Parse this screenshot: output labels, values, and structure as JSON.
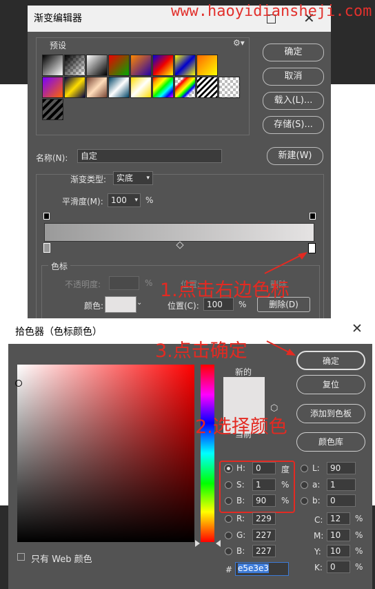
{
  "watermark": "www.haoyidiansheji.com",
  "gradient_editor": {
    "title": "渐变编辑器",
    "presets_label": "预设",
    "buttons": {
      "ok": "确定",
      "cancel": "取消",
      "load": "载入(L)...",
      "save": "存储(S)...",
      "new": "新建(W)"
    },
    "name_label": "名称(N):",
    "name_value": "自定",
    "type_label": "渐变类型:",
    "type_value": "实底",
    "smoothness_label": "平滑度(M):",
    "smoothness_value": "100",
    "smoothness_unit": "%",
    "stops_label": "色标",
    "opacity_label": "不透明度:",
    "opacity_unit": "%",
    "position_label_dim": "位置:",
    "delete_label_dim": "删除",
    "color_label": "颜色:",
    "position_label": "位置(C):",
    "position_value": "100",
    "position_unit": "%",
    "delete_button": "删除(D)"
  },
  "annotations": {
    "step1": "1.点击右边色标",
    "step2": "2.选择颜色",
    "step3": "3.点击确定"
  },
  "color_picker": {
    "title": "拾色器（色标颜色）",
    "new_label": "新的",
    "current_label": "当前",
    "buttons": {
      "ok": "确定",
      "reset": "复位",
      "add_swatch": "添加到色板",
      "libraries": "颜色库"
    },
    "web_only_label": "只有 Web 颜色",
    "hsb": [
      {
        "label": "H:",
        "value": "0",
        "unit": "度"
      },
      {
        "label": "S:",
        "value": "1",
        "unit": "%"
      },
      {
        "label": "B:",
        "value": "90",
        "unit": "%"
      }
    ],
    "rgb": [
      {
        "label": "R:",
        "value": "229"
      },
      {
        "label": "G:",
        "value": "227"
      },
      {
        "label": "B:",
        "value": "227"
      }
    ],
    "lab": [
      {
        "label": "L:",
        "value": "90"
      },
      {
        "label": "a:",
        "value": "1"
      },
      {
        "label": "b:",
        "value": "0"
      }
    ],
    "cmyk": [
      {
        "label": "C:",
        "value": "12",
        "unit": "%"
      },
      {
        "label": "M:",
        "value": "10",
        "unit": "%"
      },
      {
        "label": "Y:",
        "value": "10",
        "unit": "%"
      },
      {
        "label": "K:",
        "value": "0",
        "unit": "%"
      }
    ],
    "hex_label": "#",
    "hex_value": "e5e3e3"
  },
  "colors": {
    "accent_red": "#e32a22",
    "selected_color": "#e5e3e3",
    "panel_bg": "#535353"
  }
}
